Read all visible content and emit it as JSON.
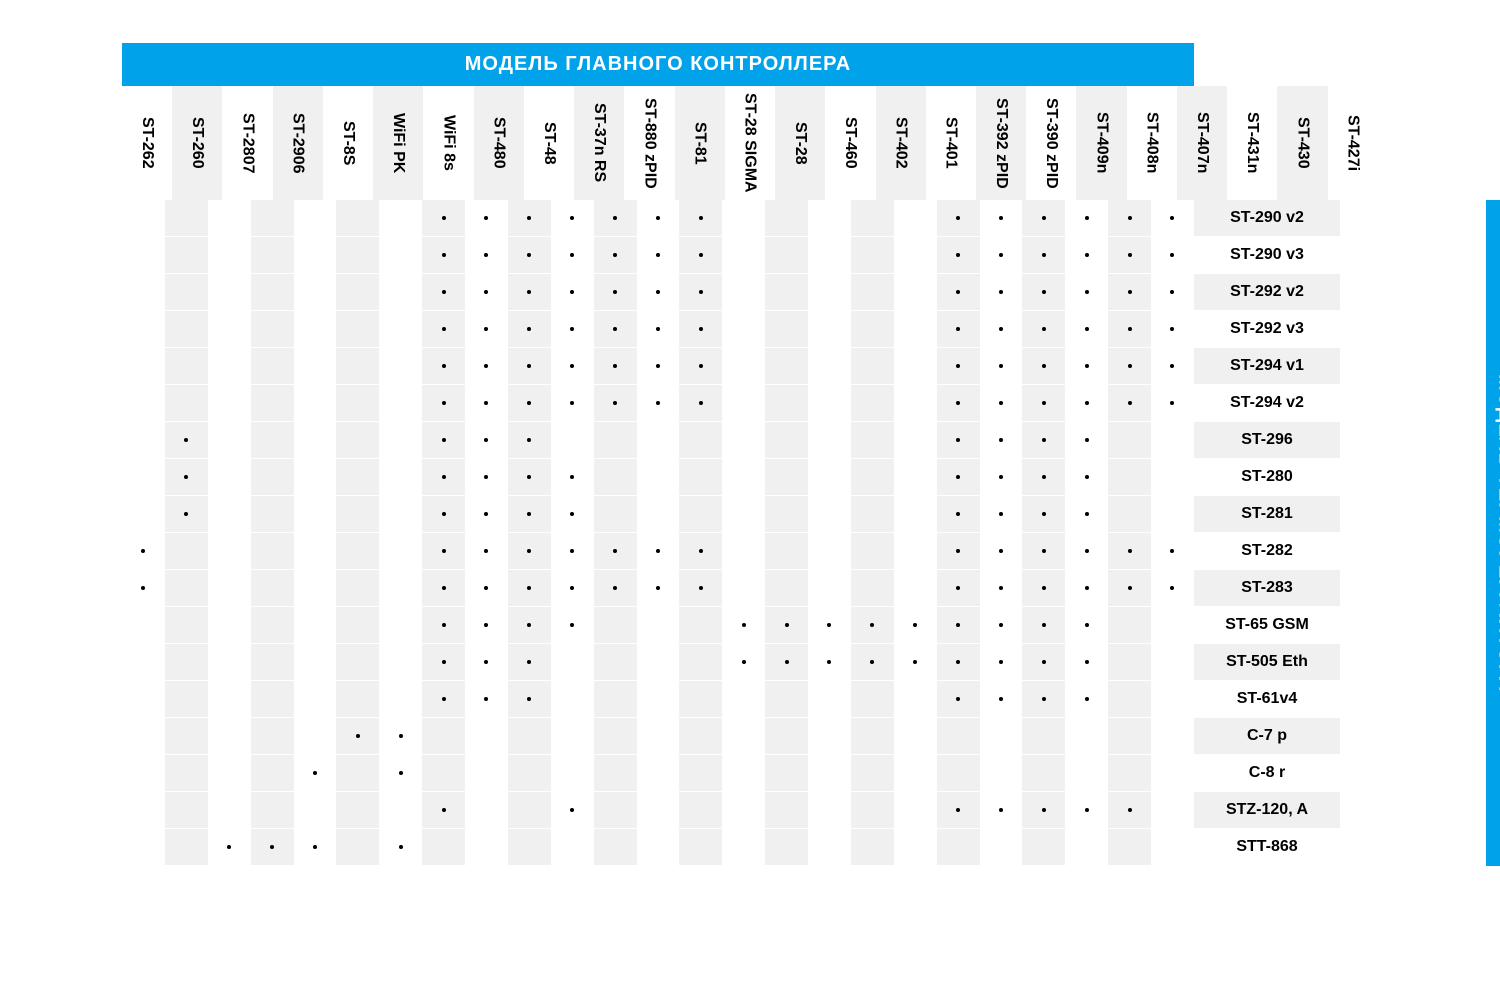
{
  "title_top": "МОДЕЛЬ ГЛАВНОГО КОНТРОЛЛЕРА",
  "title_right": "МОДЕЛЬ ТЕРМОРЕГУЛЯТОРА",
  "columns": [
    "ST-262",
    "ST-260",
    "ST-2807",
    "ST-2906",
    "ST-8S",
    "WiFi PK",
    "WiFi 8s",
    "ST-480",
    "ST-48",
    "ST-37n RS",
    "ST-880 zPID",
    "ST-81",
    "ST-28 SIGMA",
    "ST-28",
    "ST-460",
    "ST-402",
    "ST-401",
    "ST-392 zPID",
    "ST-390 zPID",
    "ST-409n",
    "ST-408n",
    "ST-407n",
    "ST-431n",
    "ST-430",
    "ST-427i"
  ],
  "rows": [
    {
      "label": "ST-290 v2",
      "marks": [
        0,
        0,
        0,
        0,
        0,
        0,
        0,
        1,
        1,
        1,
        1,
        1,
        1,
        1,
        0,
        0,
        0,
        0,
        0,
        1,
        1,
        1,
        1,
        1,
        1
      ]
    },
    {
      "label": "ST-290 v3",
      "marks": [
        0,
        0,
        0,
        0,
        0,
        0,
        0,
        1,
        1,
        1,
        1,
        1,
        1,
        1,
        0,
        0,
        0,
        0,
        0,
        1,
        1,
        1,
        1,
        1,
        1
      ]
    },
    {
      "label": "ST-292 v2",
      "marks": [
        0,
        0,
        0,
        0,
        0,
        0,
        0,
        1,
        1,
        1,
        1,
        1,
        1,
        1,
        0,
        0,
        0,
        0,
        0,
        1,
        1,
        1,
        1,
        1,
        1
      ]
    },
    {
      "label": "ST-292 v3",
      "marks": [
        0,
        0,
        0,
        0,
        0,
        0,
        0,
        1,
        1,
        1,
        1,
        1,
        1,
        1,
        0,
        0,
        0,
        0,
        0,
        1,
        1,
        1,
        1,
        1,
        1
      ]
    },
    {
      "label": "ST-294 v1",
      "marks": [
        0,
        0,
        0,
        0,
        0,
        0,
        0,
        1,
        1,
        1,
        1,
        1,
        1,
        1,
        0,
        0,
        0,
        0,
        0,
        1,
        1,
        1,
        1,
        1,
        1
      ]
    },
    {
      "label": "ST-294 v2",
      "marks": [
        0,
        0,
        0,
        0,
        0,
        0,
        0,
        1,
        1,
        1,
        1,
        1,
        1,
        1,
        0,
        0,
        0,
        0,
        0,
        1,
        1,
        1,
        1,
        1,
        1
      ]
    },
    {
      "label": "ST-296",
      "marks": [
        0,
        1,
        0,
        0,
        0,
        0,
        0,
        1,
        1,
        1,
        0,
        0,
        0,
        0,
        0,
        0,
        0,
        0,
        0,
        1,
        1,
        1,
        1,
        0,
        0
      ]
    },
    {
      "label": "ST-280",
      "marks": [
        0,
        1,
        0,
        0,
        0,
        0,
        0,
        1,
        1,
        1,
        1,
        0,
        0,
        0,
        0,
        0,
        0,
        0,
        0,
        1,
        1,
        1,
        1,
        0,
        0
      ]
    },
    {
      "label": "ST-281",
      "marks": [
        0,
        1,
        0,
        0,
        0,
        0,
        0,
        1,
        1,
        1,
        1,
        0,
        0,
        0,
        0,
        0,
        0,
        0,
        0,
        1,
        1,
        1,
        1,
        0,
        0
      ]
    },
    {
      "label": "ST-282",
      "marks": [
        1,
        0,
        0,
        0,
        0,
        0,
        0,
        1,
        1,
        1,
        1,
        1,
        1,
        1,
        0,
        0,
        0,
        0,
        0,
        1,
        1,
        1,
        1,
        1,
        1
      ]
    },
    {
      "label": "ST-283",
      "marks": [
        1,
        0,
        0,
        0,
        0,
        0,
        0,
        1,
        1,
        1,
        1,
        1,
        1,
        1,
        0,
        0,
        0,
        0,
        0,
        1,
        1,
        1,
        1,
        1,
        1
      ]
    },
    {
      "label": "ST-65 GSM",
      "marks": [
        0,
        0,
        0,
        0,
        0,
        0,
        0,
        1,
        1,
        1,
        1,
        0,
        0,
        0,
        1,
        1,
        1,
        1,
        1,
        1,
        1,
        1,
        1,
        0,
        0
      ]
    },
    {
      "label": "ST-505 Eth",
      "marks": [
        0,
        0,
        0,
        0,
        0,
        0,
        0,
        1,
        1,
        1,
        0,
        0,
        0,
        0,
        1,
        1,
        1,
        1,
        1,
        1,
        1,
        1,
        1,
        0,
        0
      ]
    },
    {
      "label": "ST-61v4",
      "marks": [
        0,
        0,
        0,
        0,
        0,
        0,
        0,
        1,
        1,
        1,
        0,
        0,
        0,
        0,
        0,
        0,
        0,
        0,
        0,
        1,
        1,
        1,
        1,
        0,
        0
      ]
    },
    {
      "label": "C-7 p",
      "marks": [
        0,
        0,
        0,
        0,
        0,
        1,
        1,
        0,
        0,
        0,
        0,
        0,
        0,
        0,
        0,
        0,
        0,
        0,
        0,
        0,
        0,
        0,
        0,
        0,
        0
      ]
    },
    {
      "label": "C-8 r",
      "marks": [
        0,
        0,
        0,
        0,
        1,
        0,
        1,
        0,
        0,
        0,
        0,
        0,
        0,
        0,
        0,
        0,
        0,
        0,
        0,
        0,
        0,
        0,
        0,
        0,
        0
      ]
    },
    {
      "label": "STZ-120, A",
      "marks": [
        0,
        0,
        0,
        0,
        0,
        0,
        0,
        1,
        0,
        0,
        1,
        0,
        0,
        0,
        0,
        0,
        0,
        0,
        0,
        1,
        1,
        1,
        1,
        1,
        0
      ]
    },
    {
      "label": "STT-868",
      "marks": [
        0,
        0,
        1,
        1,
        1,
        0,
        1,
        0,
        0,
        0,
        0,
        0,
        0,
        0,
        0,
        0,
        0,
        0,
        0,
        0,
        0,
        0,
        0,
        0,
        0
      ]
    }
  ]
}
